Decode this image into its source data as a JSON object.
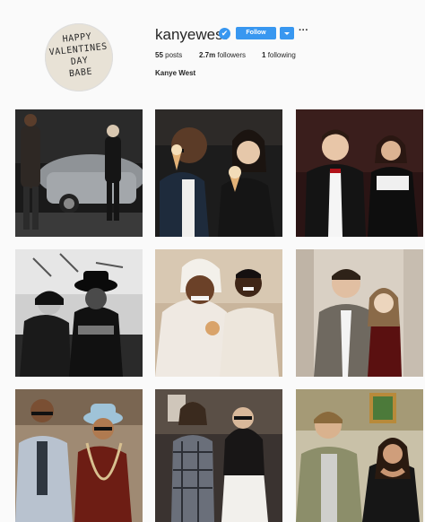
{
  "profile": {
    "avatar_text": "HAPPY\nVALENTINES\nDAY\nBABE",
    "username": "kanyewest",
    "verified_icon": "✔",
    "follow_label": "Follow",
    "more_label": "···",
    "posts_count": "55",
    "posts_label": "posts",
    "followers_count": "2.7m",
    "followers_label": "followers",
    "following_count": "1",
    "following_label": "following",
    "full_name": "Kanye West"
  },
  "colors": {
    "accent": "#3897f0",
    "background": "#fafafa"
  },
  "posts": [
    {
      "subject": "couple next to silver car at night"
    },
    {
      "subject": "couple eating ice cream"
    },
    {
      "subject": "couple in formal wear"
    },
    {
      "subject": "black and white couple photo"
    },
    {
      "subject": "bride and groom embracing"
    },
    {
      "subject": "couple at party"
    },
    {
      "subject": "couple in suits and hat"
    },
    {
      "subject": "couple in plaid and white"
    },
    {
      "subject": "couple in jacket and black dress"
    }
  ]
}
